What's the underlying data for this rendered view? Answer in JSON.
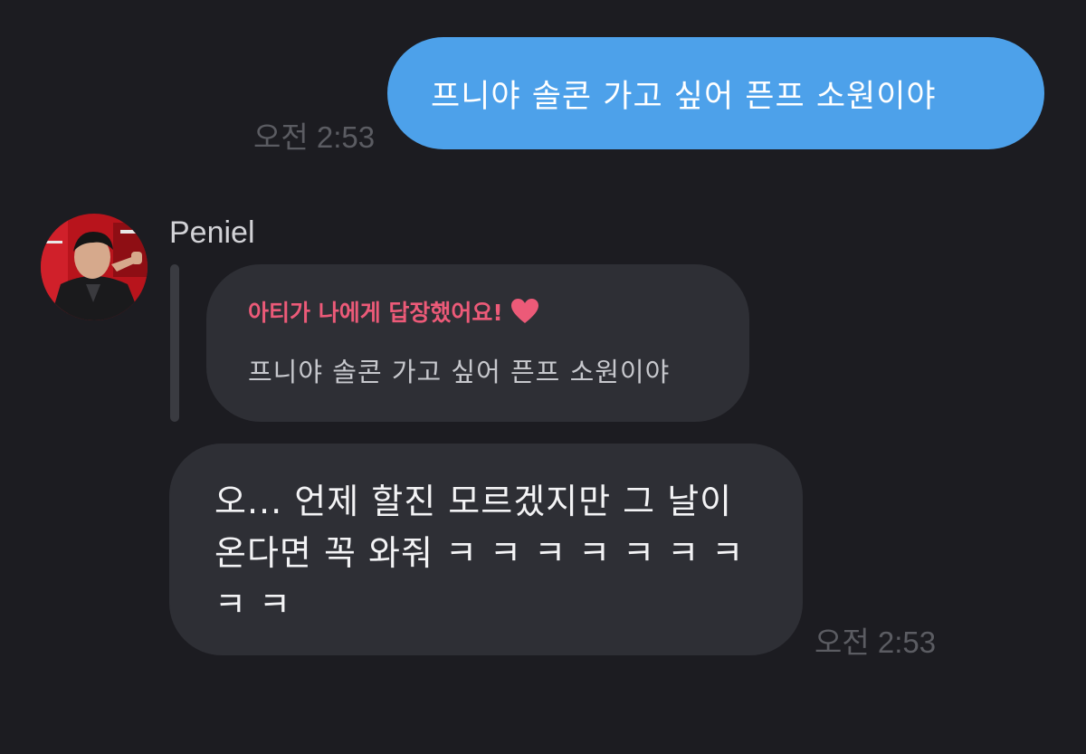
{
  "sent_message": {
    "text": "프니야 솔콘 가고 싶어 픈프 소원이야",
    "time": "오전 2:53"
  },
  "received_message": {
    "sender": "Peniel",
    "reply_header": "아티가 나에게 답장했어요!",
    "reply_icon": "heart-icon",
    "quoted_text": "프니야 솔콘 가고 싶어 픈프 소원이야",
    "text_lines": [
      "오... 언제 할진 모르겠지만 그 날이",
      "온다면 꼭 와줘 ㅋ ㅋ ㅋ ㅋ ㅋ ㅋ ㅋ",
      "ㅋ ㅋ"
    ],
    "time": "오전 2:53"
  },
  "colors": {
    "background": "#1c1c21",
    "sent_bubble": "#4da1ea",
    "received_bubble": "#2e2f35",
    "accent_pink": "#ec5a78",
    "timestamp": "#5b5c62"
  }
}
